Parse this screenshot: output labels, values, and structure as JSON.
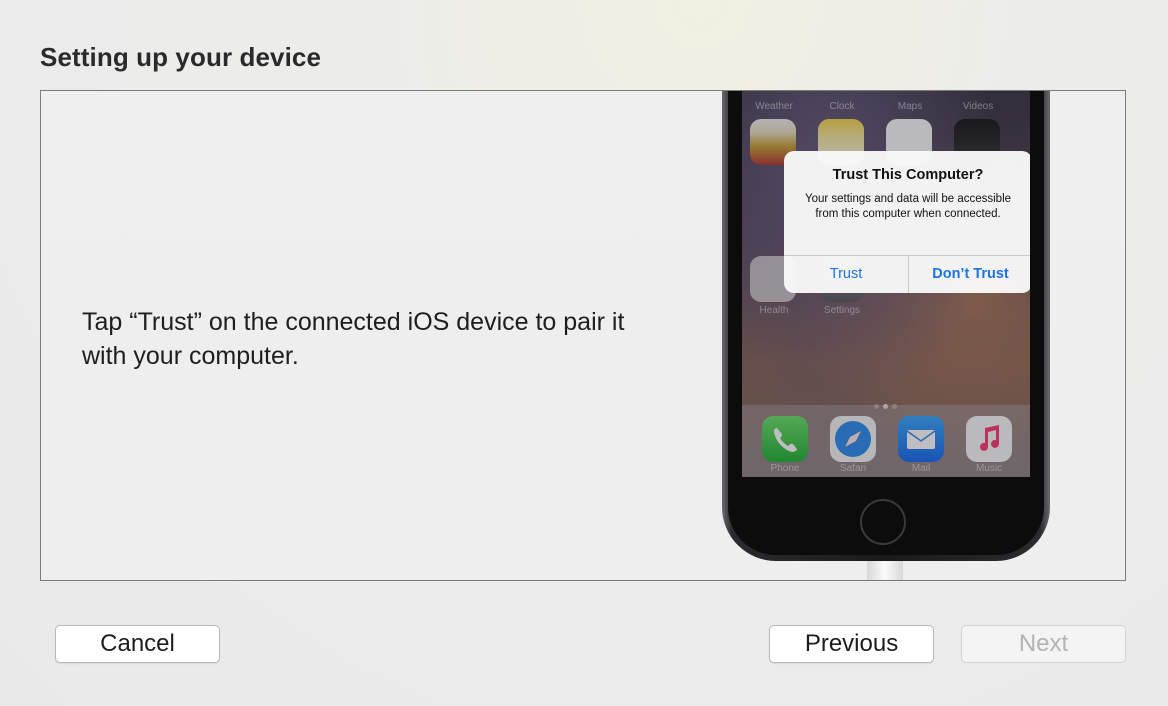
{
  "header": {
    "title": "Setting up your device"
  },
  "main": {
    "instruction": "Tap “Trust” on the connected iOS device to pair it with your computer."
  },
  "phone": {
    "home_top_row_labels": [
      "Weather",
      "Clock",
      "Maps",
      "Videos"
    ],
    "home_mid_row_labels": [
      "Health",
      "Settings"
    ],
    "dock_labels": [
      "Phone",
      "Safari",
      "Mail",
      "Music"
    ],
    "alert": {
      "title": "Trust This Computer?",
      "message": "Your settings and data will be accessible from this computer when connected.",
      "trust_label": "Trust",
      "dont_trust_label": "Don’t Trust"
    }
  },
  "footer": {
    "cancel_label": "Cancel",
    "previous_label": "Previous",
    "next_label": "Next",
    "next_enabled": false
  }
}
